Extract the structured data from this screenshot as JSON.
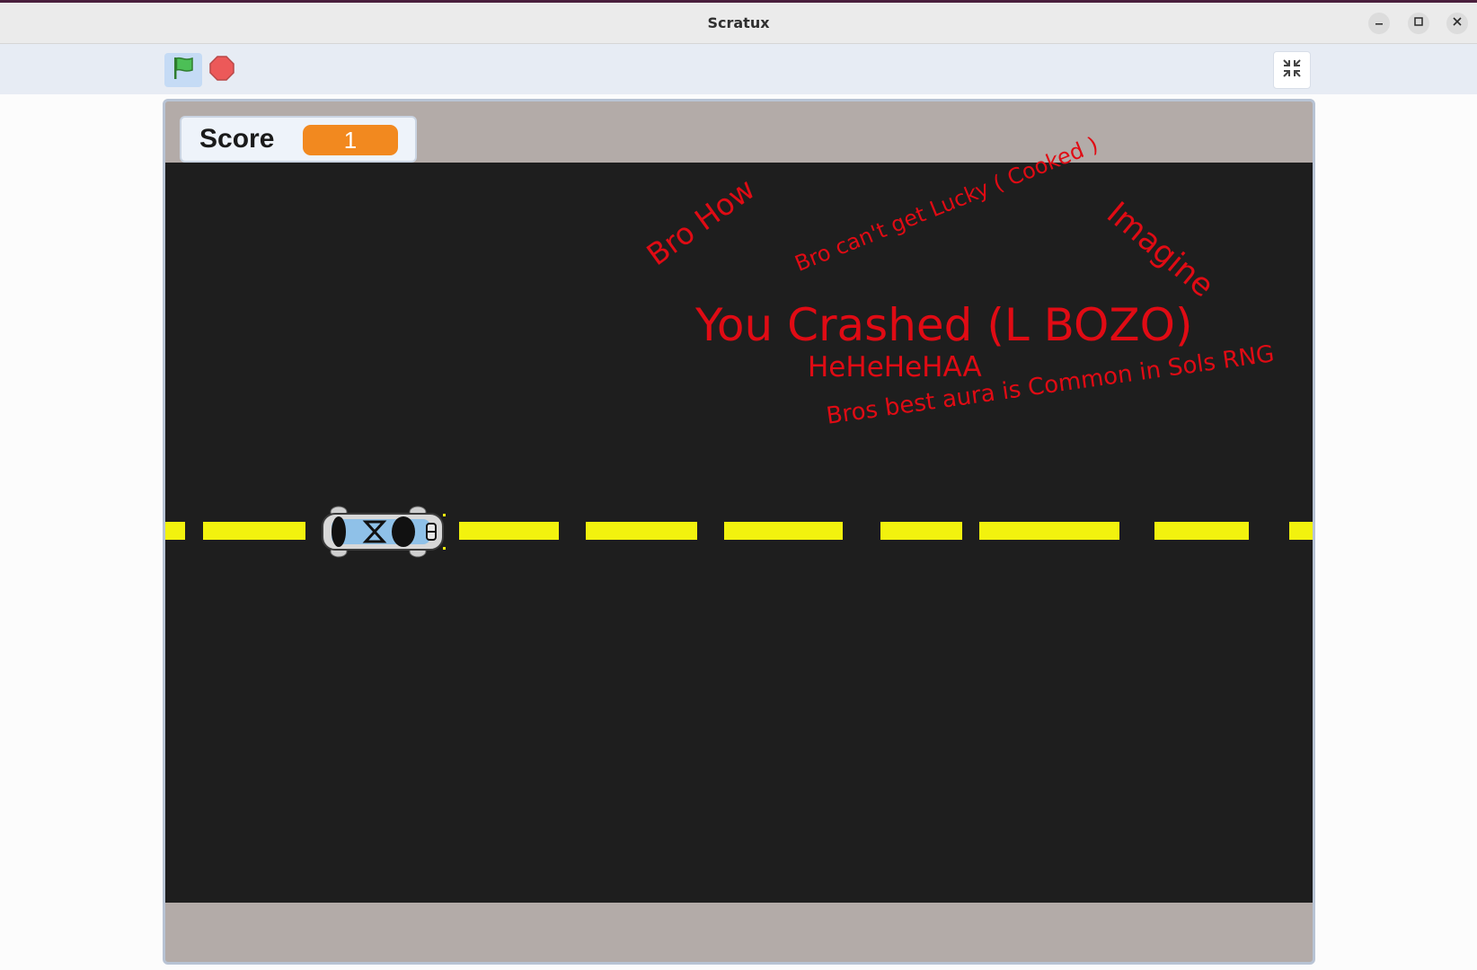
{
  "window": {
    "title": "Scratux",
    "minimize_icon": "minimize-icon",
    "maximize_icon": "maximize-icon",
    "close_icon": "close-icon"
  },
  "toolbar": {
    "green_flag_icon": "green-flag-icon",
    "stop_icon": "stop-sign-icon",
    "fullscreen_icon": "exit-fullscreen-icon"
  },
  "stage": {
    "score_monitor": {
      "label": "Score",
      "value": "1"
    },
    "messages": {
      "main": "You Crashed (L BOZO)",
      "laugh": "HeHeHeHAA",
      "bro_how": "Bro How",
      "lucky": "Bro can't get Lucky ( Cooked )",
      "imagine": "Imagine",
      "aura": "Bros best aura is Common in Sols RNG"
    },
    "sprite": "car-sprite"
  },
  "colors": {
    "road": "#1e1e1e",
    "lane_marking": "#f2f20e",
    "message_text": "#e00b14",
    "monitor_value_bg": "#f2891f",
    "stage_border": "#b3aba8"
  }
}
